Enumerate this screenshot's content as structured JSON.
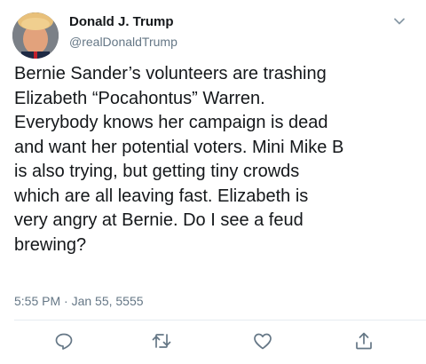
{
  "tweet": {
    "author": {
      "display_name": "Donald J. Trump",
      "handle": "@realDonaldTrump",
      "avatar_icon": "profile-avatar"
    },
    "text": "Bernie Sander’s volunteers are trashing\nElizabeth “Pocahontus” Warren.\nEverybody knows her campaign is dead\nand want her potential voters. Mini Mike B\nis also trying, but getting tiny crowds\nwhich are all leaving fast. Elizabeth is\nvery angry at Bernie. Do I see a feud\nbrewing?",
    "timestamp": "5:55 PM · Jan 55, 5555",
    "menu_icon": "chevron-down-icon"
  },
  "actions": [
    {
      "name": "reply",
      "icon": "reply-icon"
    },
    {
      "name": "retweet",
      "icon": "retweet-icon"
    },
    {
      "name": "like",
      "icon": "heart-icon"
    },
    {
      "name": "share",
      "icon": "share-icon"
    }
  ],
  "colors": {
    "text": "#14171a",
    "secondary": "#657786",
    "icon": "#657786",
    "divider": "#e6ecf0"
  }
}
